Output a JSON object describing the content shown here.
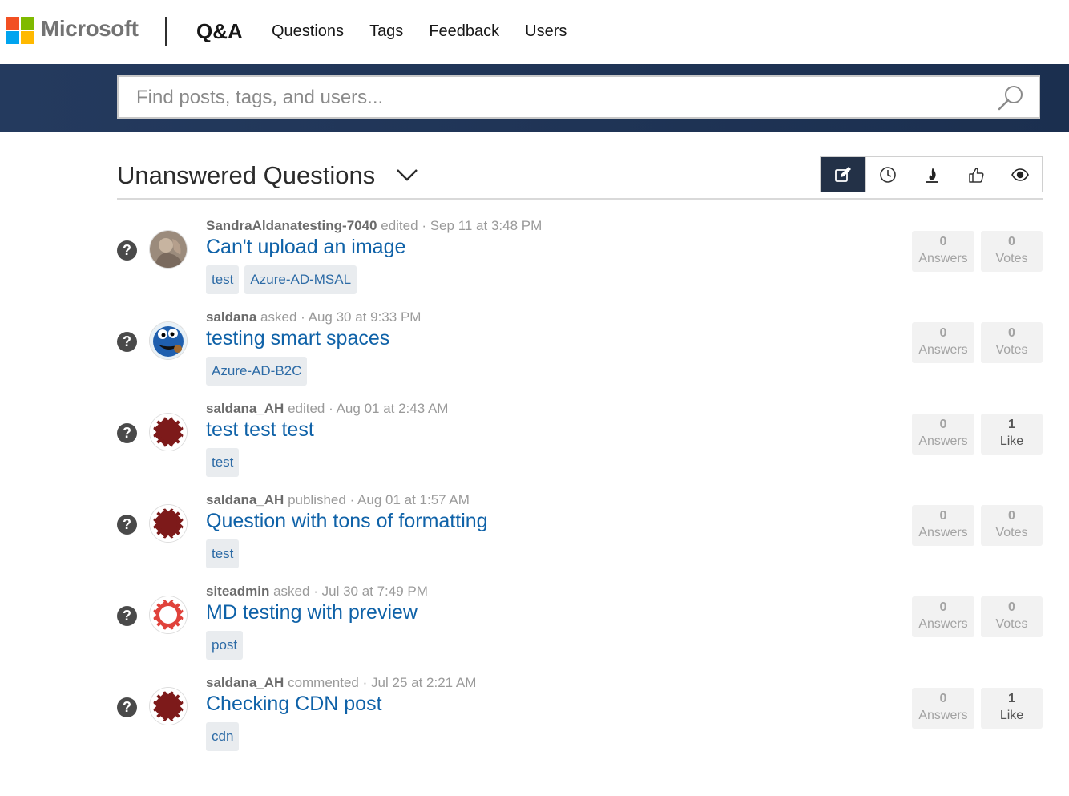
{
  "header": {
    "brand": "Microsoft",
    "product": "Q&A",
    "nav": [
      "Questions",
      "Tags",
      "Feedback",
      "Users"
    ]
  },
  "search": {
    "placeholder": "Find posts, tags, and users..."
  },
  "section": {
    "title": "Unanswered Questions",
    "sort_buttons": [
      "edit-icon",
      "clock-icon",
      "flame-icon",
      "thumbs-up-icon",
      "eye-icon"
    ]
  },
  "questions": [
    {
      "user": "SandraAldanatesting-7040",
      "action": "edited",
      "when": "Sep 11 at 3:48 PM",
      "title": "Can't upload an image",
      "tags": [
        "test",
        "Azure-AD-MSAL"
      ],
      "answers": "0",
      "answers_label": "Answers",
      "votes": "0",
      "votes_label": "Votes",
      "avatar": "photo"
    },
    {
      "user": "saldana",
      "action": "asked",
      "when": "Aug 30 at 9:33 PM",
      "title": "testing smart spaces",
      "tags": [
        "Azure-AD-B2C"
      ],
      "answers": "0",
      "answers_label": "Answers",
      "votes": "0",
      "votes_label": "Votes",
      "avatar": "cookie"
    },
    {
      "user": "saldana_AH",
      "action": "edited",
      "when": "Aug 01 at 2:43 AM",
      "title": "test test test",
      "tags": [
        "test"
      ],
      "answers": "0",
      "answers_label": "Answers",
      "votes": "1",
      "votes_label": "Like",
      "avatar": "maroon"
    },
    {
      "user": "saldana_AH",
      "action": "published",
      "when": "Aug 01 at 1:57 AM",
      "title": "Question with tons of formatting",
      "tags": [
        "test"
      ],
      "answers": "0",
      "answers_label": "Answers",
      "votes": "0",
      "votes_label": "Votes",
      "avatar": "maroon"
    },
    {
      "user": "siteadmin",
      "action": "asked",
      "when": "Jul 30 at 7:49 PM",
      "title": "MD testing with preview",
      "tags": [
        "post"
      ],
      "answers": "0",
      "answers_label": "Answers",
      "votes": "0",
      "votes_label": "Votes",
      "avatar": "red"
    },
    {
      "user": "saldana_AH",
      "action": "commented",
      "when": "Jul 25 at 2:21 AM",
      "title": "Checking CDN post",
      "tags": [
        "cdn"
      ],
      "answers": "0",
      "answers_label": "Answers",
      "votes": "1",
      "votes_label": "Like",
      "avatar": "maroon"
    }
  ],
  "colors": {
    "brand_band": "#243a5e",
    "link": "#0f62a8",
    "active_sort": "#233147"
  }
}
